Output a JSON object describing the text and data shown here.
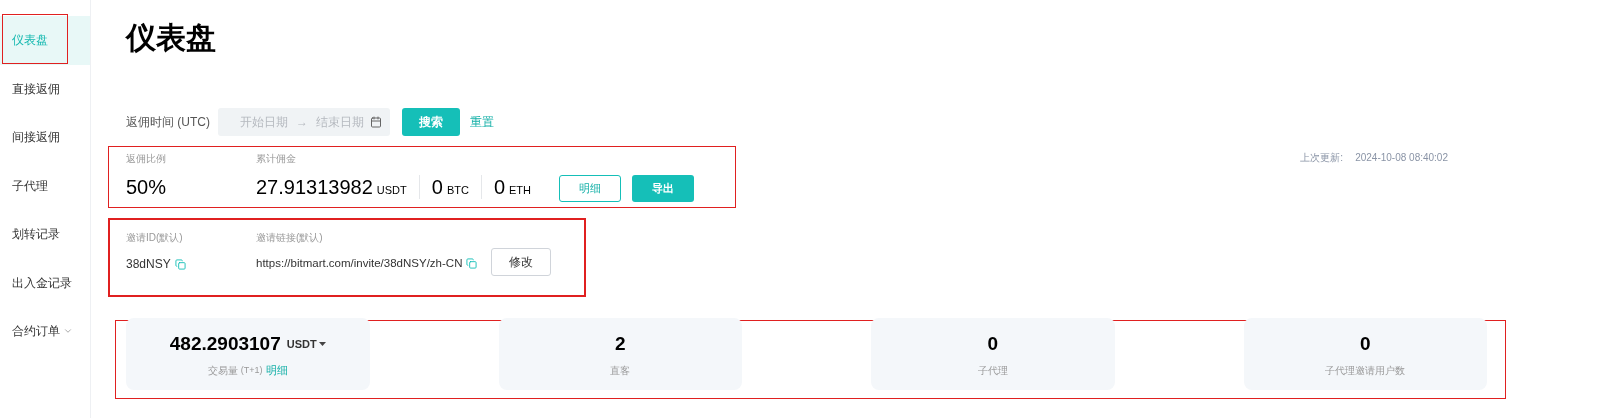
{
  "sidebar": {
    "items": [
      {
        "label": "仪表盘",
        "selected": true
      },
      {
        "label": "直接返佣",
        "selected": false
      },
      {
        "label": "间接返佣",
        "selected": false
      },
      {
        "label": "子代理",
        "selected": false
      },
      {
        "label": "划转记录",
        "selected": false
      },
      {
        "label": "出入金记录",
        "selected": false
      },
      {
        "label": "合约订单",
        "selected": false,
        "expandable": true
      }
    ]
  },
  "title": "仪表盘",
  "filter": {
    "label": "返佣时间 (UTC)",
    "start_placeholder": "开始日期",
    "separator": "→",
    "end_placeholder": "结束日期",
    "search_button": "搜索",
    "reset_link": "重置"
  },
  "last_update": {
    "label": "上次更新:",
    "value": "2024-10-08 08:40:02"
  },
  "commission": {
    "rate_label": "返佣比例",
    "rate": "50%",
    "total_label": "累计佣金",
    "amounts": [
      {
        "value": "27.91313982",
        "unit": "USDT"
      },
      {
        "value": "0",
        "unit": "BTC"
      },
      {
        "value": "0",
        "unit": "ETH"
      }
    ],
    "details_button": "明细",
    "export_button": "导出"
  },
  "invite": {
    "id_label": "邀请ID(默认)",
    "id": "38dNSY",
    "link_label": "邀请链接(默认)",
    "link": "https://bitmart.com/invite/38dNSY/zh-CN",
    "edit_button": "修改"
  },
  "stats": [
    {
      "value": "482.2903107",
      "unit": "USDT",
      "label": "交易量",
      "sub": "(T+1)",
      "link": "明细"
    },
    {
      "value": "2",
      "label": "直客"
    },
    {
      "value": "0",
      "label": "子代理"
    },
    {
      "value": "0",
      "label": "子代理邀请用户数"
    }
  ]
}
